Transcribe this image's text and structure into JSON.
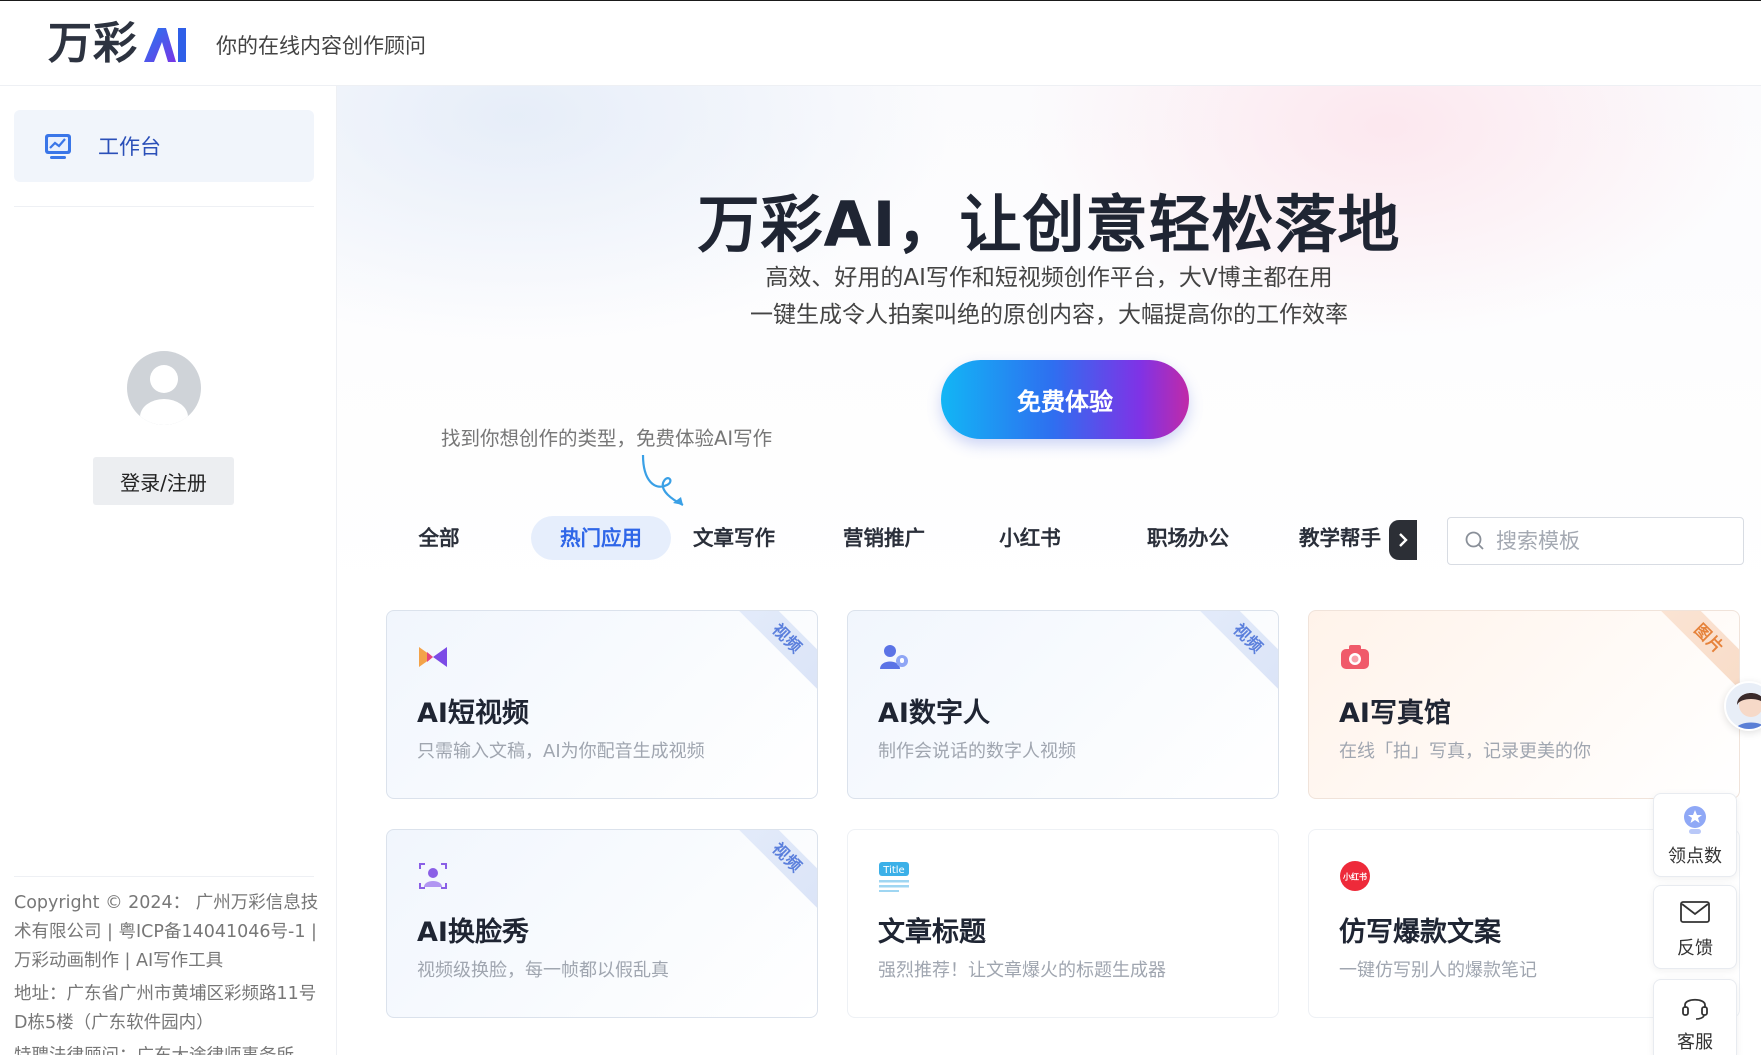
{
  "header": {
    "logo_text": "万彩",
    "logo_ai": "AI",
    "tagline": "你的在线内容创作顾问"
  },
  "sidebar": {
    "workbench_label": "工作台",
    "login_label": "登录/注册",
    "footer_line1": "Copyright © 2024： 广州万彩信息技术有限公司 | 粤ICP备14041046号-1 | 万彩动画制作 | AI写作工具",
    "footer_line2": "地址：广东省广州市黄埔区彩频路11号D栋5楼（广东软件园内）",
    "footer_line3": "特聘法律顾问：广东大途律师事务所"
  },
  "hero": {
    "title": "万彩AI，让创意轻松落地",
    "subtitle1": "高效、好用的AI写作和短视频创作平台，大V博主都在用",
    "subtitle2": "一键生成令人拍案叫绝的原创内容，大幅提高你的工作效率",
    "cta_label": "免费体验",
    "hint": "找到你想创作的类型，免费体验AI写作"
  },
  "tabs": [
    {
      "label": "全部",
      "active": false
    },
    {
      "label": "热门应用",
      "active": true
    },
    {
      "label": "文章写作",
      "active": false
    },
    {
      "label": "营销推广",
      "active": false
    },
    {
      "label": "小红书",
      "active": false
    },
    {
      "label": "职场办公",
      "active": false
    },
    {
      "label": "教学帮手",
      "active": false
    }
  ],
  "search": {
    "placeholder": "搜索模板"
  },
  "cards": [
    {
      "title": "AI短视频",
      "desc": "只需输入文稿，AI为你配音生成视频",
      "badge": "视频",
      "icon": "bowtie-play-icon"
    },
    {
      "title": "AI数字人",
      "desc": "制作会说话的数字人视频",
      "badge": "视频",
      "icon": "digital-person-icon"
    },
    {
      "title": "AI写真馆",
      "desc": "在线「拍」写真，记录更美的你",
      "badge": "图片",
      "icon": "camera-icon"
    },
    {
      "title": "AI换脸秀",
      "desc": "视频级换脸，每一帧都以假乱真",
      "badge": "视频",
      "icon": "face-scan-icon"
    },
    {
      "title": "文章标题",
      "desc": "强烈推荐！让文章爆火的标题生成器",
      "badge": "",
      "icon": "title-doc-icon",
      "icon_text": "Title"
    },
    {
      "title": "仿写爆款文案",
      "desc": "一键仿写别人的爆款笔记",
      "badge": "",
      "icon": "xiaohongshu-icon",
      "icon_text": "小红书"
    }
  ],
  "float": {
    "points_label": "领点数",
    "feedback_label": "反馈",
    "service_label": "客服"
  },
  "colors": {
    "accent": "#2f66e8",
    "cta_start": "#12b6f5",
    "cta_end": "#c02aa8",
    "badge_video": "#5b7fdc",
    "badge_image": "#e6823a"
  }
}
